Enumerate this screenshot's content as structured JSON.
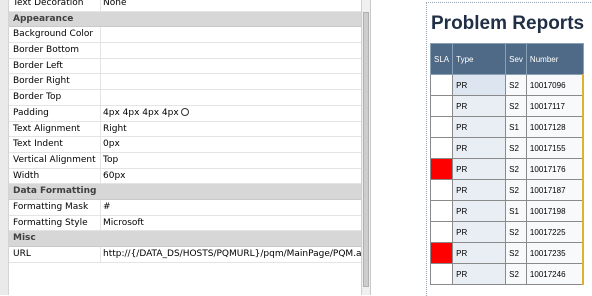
{
  "property_grid": {
    "top_partial": {
      "name": "Text Decoration",
      "value": "None"
    },
    "appearance": {
      "label": "Appearance",
      "rows": [
        {
          "name": "Background Color",
          "kind": "swatch",
          "color": "#dde6f0"
        },
        {
          "name": "Border Bottom",
          "kind": "border"
        },
        {
          "name": "Border Left",
          "kind": "border"
        },
        {
          "name": "Border Right",
          "kind": "border"
        },
        {
          "name": "Border Top",
          "kind": "border"
        },
        {
          "name": "Padding",
          "value": "4px 4px 4px 4px"
        },
        {
          "name": "Text Alignment",
          "value": "Right"
        },
        {
          "name": "Text Indent",
          "value": "0px"
        },
        {
          "name": "Vertical Alignment",
          "value": "Top"
        },
        {
          "name": "Width",
          "value": "60px"
        }
      ]
    },
    "data_formatting": {
      "label": "Data Formatting",
      "rows": [
        {
          "name": "Formatting Mask",
          "value": "#"
        },
        {
          "name": "Formatting Style",
          "value": "Microsoft"
        }
      ]
    },
    "misc": {
      "label": "Misc",
      "rows": [
        {
          "name": "URL",
          "value": "http://{/DATA_DS/HOSTS/PQMURL}/pqm/MainPage/PQM.aspx?"
        }
      ]
    }
  },
  "report": {
    "title": "Problem Reports",
    "headers": [
      "SLA",
      "Type",
      "Sev",
      "Number"
    ],
    "rows": [
      {
        "sla_color": "#ffffff",
        "type": "PR",
        "sev": "S2",
        "number": "10017096"
      },
      {
        "sla_color": "#ffffff",
        "type": "PR",
        "sev": "S2",
        "number": "10017117"
      },
      {
        "sla_color": "#ffffff",
        "type": "PR",
        "sev": "S1",
        "number": "10017128"
      },
      {
        "sla_color": "#ffffff",
        "type": "PR",
        "sev": "S2",
        "number": "10017155"
      },
      {
        "sla_color": "#ff0000",
        "type": "PR",
        "sev": "S2",
        "number": "10017176"
      },
      {
        "sla_color": "#ffffff",
        "type": "PR",
        "sev": "S2",
        "number": "10017187"
      },
      {
        "sla_color": "#ffffff",
        "type": "PR",
        "sev": "S1",
        "number": "10017198"
      },
      {
        "sla_color": "#ffffff",
        "type": "PR",
        "sev": "S2",
        "number": "10017225"
      },
      {
        "sla_color": "#ff0000",
        "type": "PR",
        "sev": "S2",
        "number": "10017235"
      },
      {
        "sla_color": "#ffffff",
        "type": "PR",
        "sev": "S2",
        "number": "10017246"
      }
    ]
  }
}
